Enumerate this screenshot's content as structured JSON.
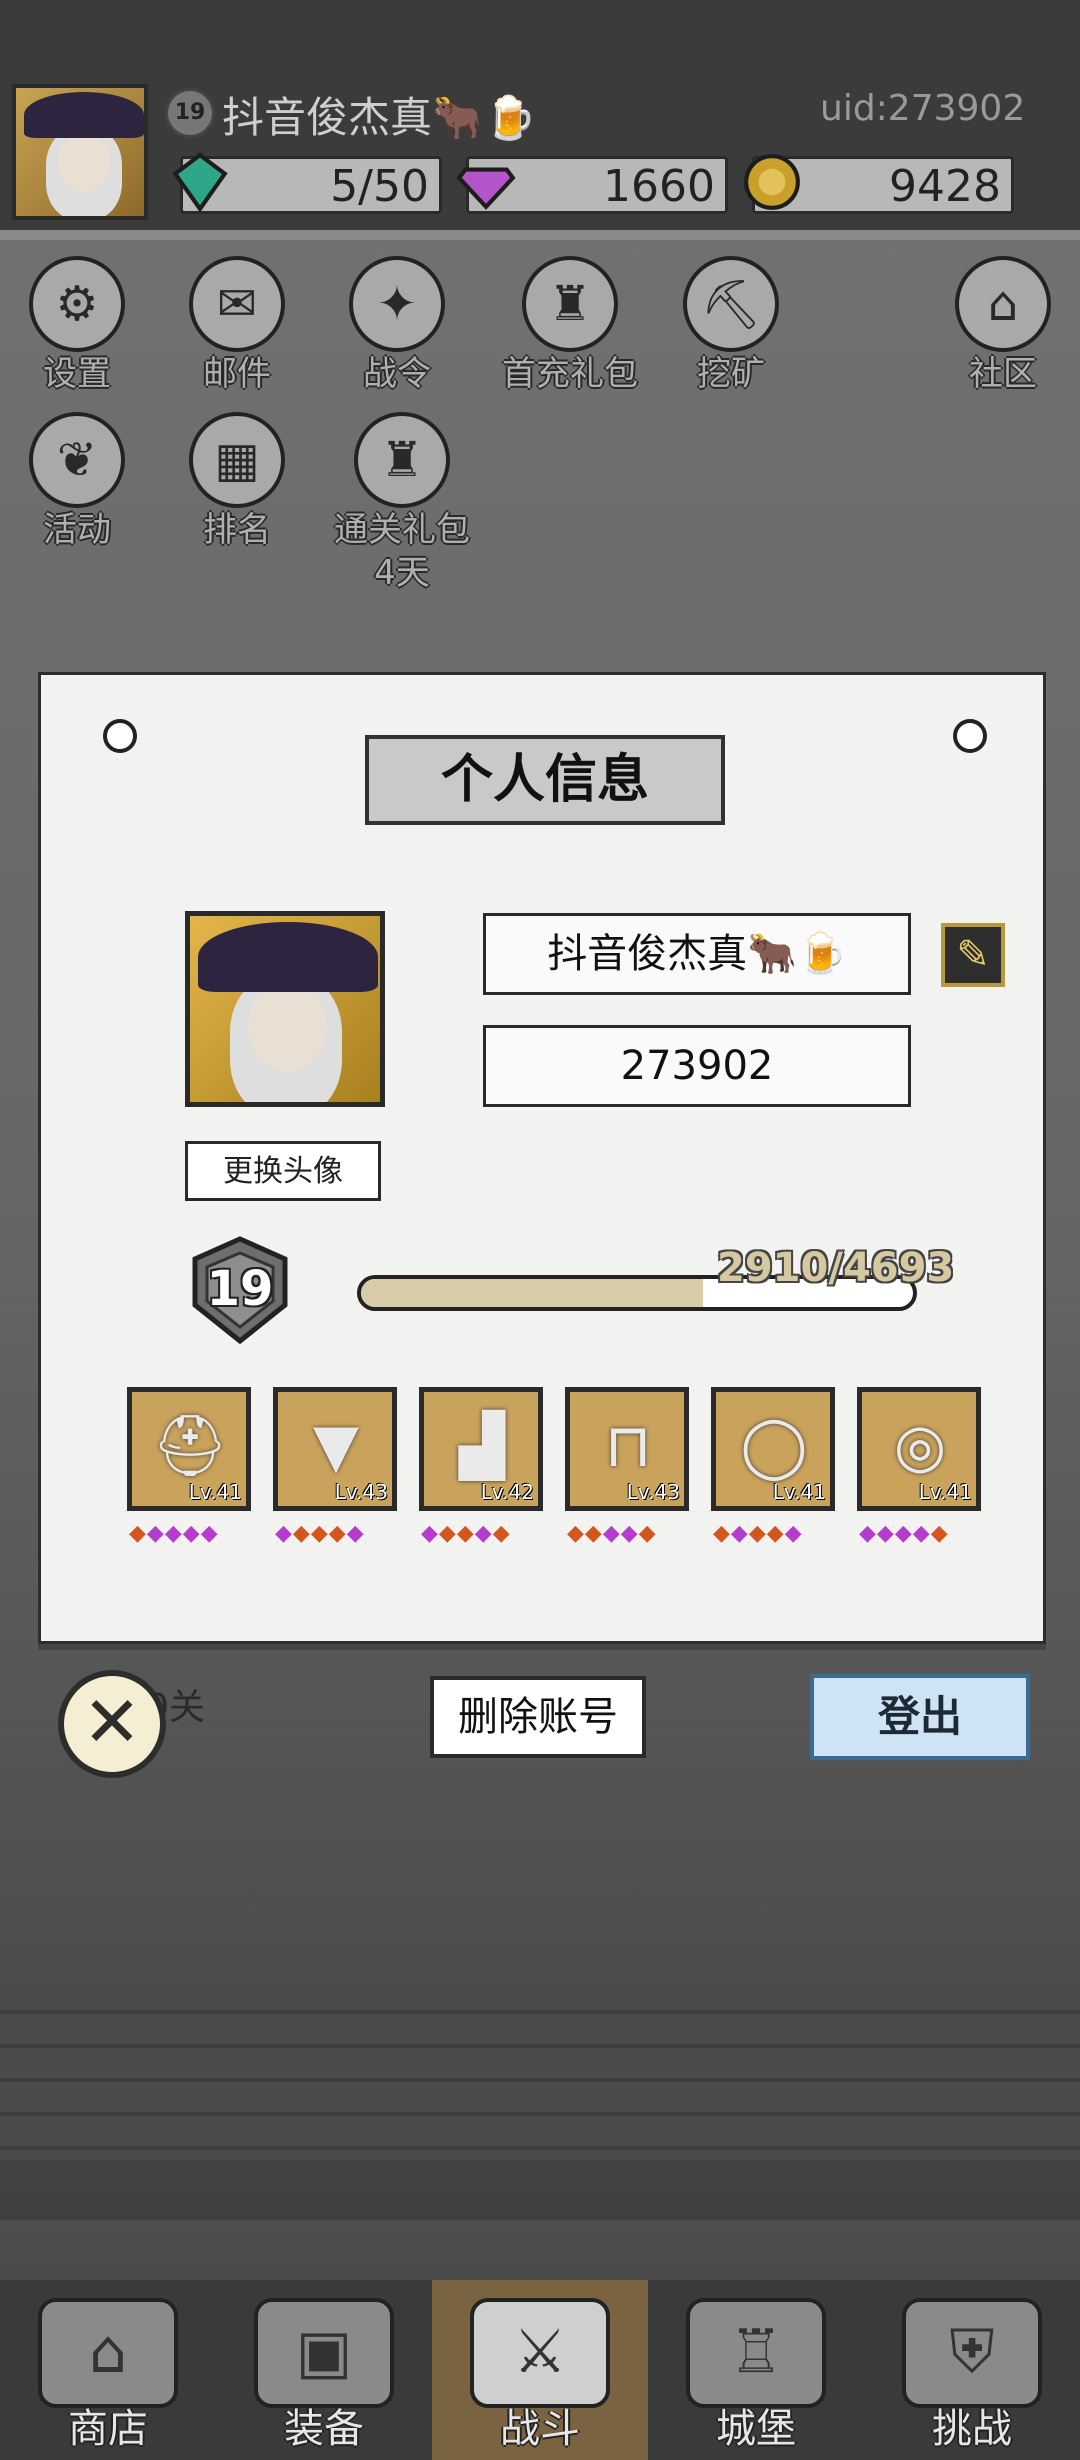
{
  "top": {
    "player_name": "抖音俊杰真🐂🍺",
    "level": "19",
    "uid": "uid:273902",
    "resources": [
      {
        "name": "energy",
        "icon": "green-gem-icon",
        "value": "5/50"
      },
      {
        "name": "diamond",
        "icon": "purple-diamond-icon",
        "value": "1660"
      },
      {
        "name": "gold",
        "icon": "gold-coin-icon",
        "value": "9428"
      }
    ]
  },
  "menu": [
    {
      "label": "设置",
      "icon": "gear-icon",
      "glyph": "⚙"
    },
    {
      "label": "邮件",
      "icon": "mail-icon",
      "glyph": "✉"
    },
    {
      "label": "战令",
      "icon": "battle-pass-icon",
      "glyph": "✦"
    },
    {
      "label": "首充礼包",
      "icon": "gift-bag-icon",
      "glyph": "♜"
    },
    {
      "label": "挖矿",
      "icon": "mining-icon",
      "glyph": "⛏"
    },
    {
      "label": "社区",
      "icon": "community-home-icon",
      "glyph": "⌂"
    },
    {
      "label": "活动",
      "icon": "laurel-icon",
      "glyph": "❦"
    },
    {
      "label": "排名",
      "icon": "ranking-icon",
      "glyph": "▦"
    },
    {
      "label": "通关礼包",
      "icon": "clear-gift-icon",
      "glyph": "♜",
      "sub": "4天"
    }
  ],
  "panel": {
    "title": "个人信息",
    "name_field": "抖音俊杰真🐂🍺",
    "id_field": "273902",
    "change_avatar": "更换头像",
    "level": "19",
    "exp_text": "2910/4693",
    "exp_ratio": 0.62,
    "equipment": [
      {
        "icon": "helmet-icon",
        "glyph": "⛑",
        "level": "Lv.41",
        "gems": [
          "o",
          "p",
          "p",
          "p",
          "p"
        ]
      },
      {
        "icon": "cloak-icon",
        "glyph": "▼",
        "level": "Lv.43",
        "gems": [
          "p",
          "o",
          "o",
          "o",
          "p"
        ]
      },
      {
        "icon": "boots-icon",
        "glyph": "▟",
        "level": "Lv.42",
        "gems": [
          "p",
          "o",
          "o",
          "p",
          "o"
        ]
      },
      {
        "icon": "pants-icon",
        "glyph": "⊓",
        "level": "Lv.43",
        "gems": [
          "o",
          "o",
          "p",
          "p",
          "o"
        ]
      },
      {
        "icon": "ring-icon",
        "glyph": "◯",
        "level": "Lv.41",
        "gems": [
          "o",
          "p",
          "o",
          "o",
          "p"
        ]
      },
      {
        "icon": "necklace-icon",
        "glyph": "◎",
        "level": "Lv.41",
        "gems": [
          "p",
          "p",
          "p",
          "p",
          "o"
        ]
      }
    ]
  },
  "buttons": {
    "delete_account": "删除账号",
    "logout": "登出",
    "close": "✕"
  },
  "background": {
    "level_text": "0关",
    "partial_text": "7"
  },
  "nav": [
    {
      "label": "商店",
      "icon": "shop-icon",
      "glyph": "⌂"
    },
    {
      "label": "装备",
      "icon": "equipment-bag-icon",
      "glyph": "▣"
    },
    {
      "label": "战斗",
      "icon": "crossed-swords-icon",
      "glyph": "⚔",
      "active": true
    },
    {
      "label": "城堡",
      "icon": "castle-icon",
      "glyph": "♖"
    },
    {
      "label": "挑战",
      "icon": "challenge-shield-icon",
      "glyph": "⛨"
    }
  ]
}
